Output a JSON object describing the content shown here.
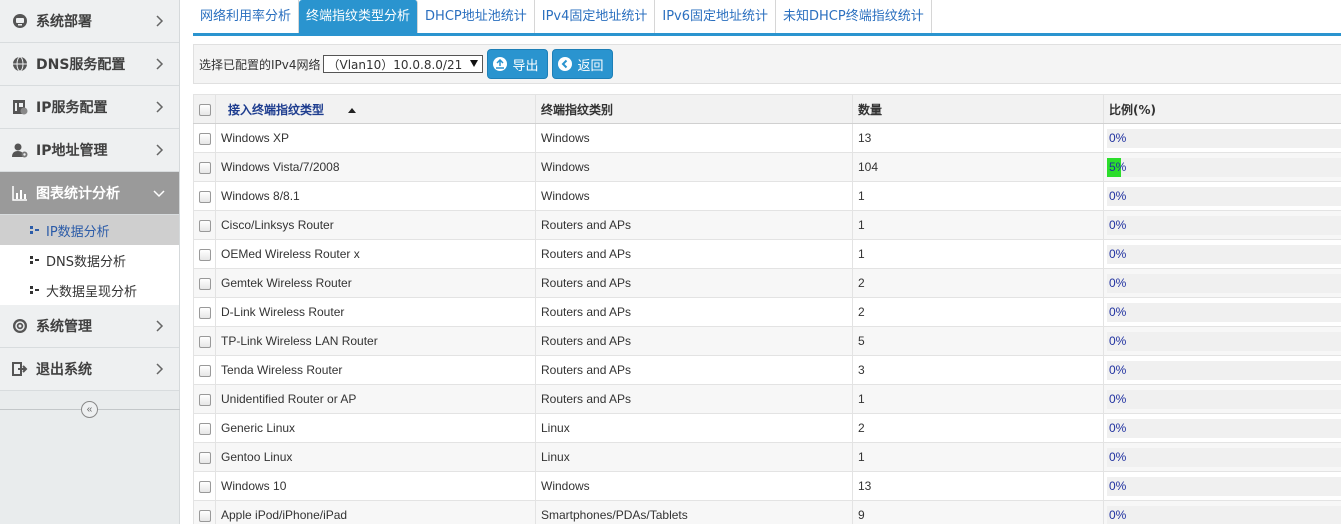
{
  "sidebar": {
    "items": [
      {
        "label": "系统部署",
        "icon": "deploy-icon"
      },
      {
        "label": "DNS服务配置",
        "icon": "globe-icon"
      },
      {
        "label": "IP服务配置",
        "icon": "ip-config-icon"
      },
      {
        "label": "IP地址管理",
        "icon": "user-gear-icon"
      },
      {
        "label": "图表统计分析",
        "icon": "bar-chart-icon"
      }
    ],
    "subitems": [
      {
        "label": "IP数据分析"
      },
      {
        "label": "DNS数据分析"
      },
      {
        "label": "大数据呈现分析"
      }
    ],
    "bottom_items": [
      {
        "label": "系统管理",
        "icon": "gear-icon"
      },
      {
        "label": "退出系统",
        "icon": "logout-icon"
      }
    ],
    "collapse_symbol": "«"
  },
  "tabs": [
    {
      "label": "网络利用率分析"
    },
    {
      "label": "终端指纹类型分析"
    },
    {
      "label": "DHCP地址池统计"
    },
    {
      "label": "IPv4固定地址统计"
    },
    {
      "label": "IPv6固定地址统计"
    },
    {
      "label": "未知DHCP终端指纹统计"
    }
  ],
  "toolbar": {
    "network_label": "选择已配置的IPv4网络",
    "network_selected": "（Vlan10）10.0.8.0/21",
    "export_label": "导出",
    "back_label": "返回"
  },
  "table": {
    "headers": [
      "接入终端指纹类型",
      "终端指纹类别",
      "数量",
      "比例(%)"
    ],
    "rows": [
      {
        "type": "Windows XP",
        "category": "Windows",
        "count": "13",
        "ratio": "0%",
        "fill": 0
      },
      {
        "type": "Windows Vista/7/2008",
        "category": "Windows",
        "count": "104",
        "ratio": "5%",
        "fill": 5
      },
      {
        "type": "Windows 8/8.1",
        "category": "Windows",
        "count": "1",
        "ratio": "0%",
        "fill": 0
      },
      {
        "type": "Cisco/Linksys Router",
        "category": "Routers and APs",
        "count": "1",
        "ratio": "0%",
        "fill": 0
      },
      {
        "type": "OEMed Wireless Router x",
        "category": "Routers and APs",
        "count": "1",
        "ratio": "0%",
        "fill": 0
      },
      {
        "type": "Gemtek Wireless Router",
        "category": "Routers and APs",
        "count": "2",
        "ratio": "0%",
        "fill": 0
      },
      {
        "type": "D-Link Wireless Router",
        "category": "Routers and APs",
        "count": "2",
        "ratio": "0%",
        "fill": 0
      },
      {
        "type": "TP-Link Wireless LAN Router",
        "category": "Routers and APs",
        "count": "5",
        "ratio": "0%",
        "fill": 0
      },
      {
        "type": "Tenda Wireless Router",
        "category": "Routers and APs",
        "count": "3",
        "ratio": "0%",
        "fill": 0
      },
      {
        "type": "Unidentified Router or AP",
        "category": "Routers and APs",
        "count": "1",
        "ratio": "0%",
        "fill": 0
      },
      {
        "type": "Generic Linux",
        "category": "Linux",
        "count": "2",
        "ratio": "0%",
        "fill": 0
      },
      {
        "type": "Gentoo Linux",
        "category": "Linux",
        "count": "1",
        "ratio": "0%",
        "fill": 0
      },
      {
        "type": "Windows 10",
        "category": "Windows",
        "count": "13",
        "ratio": "0%",
        "fill": 0
      },
      {
        "type": "Apple iPod/iPhone/iPad",
        "category": "Smartphones/PDAs/Tablets",
        "count": "9",
        "ratio": "0%",
        "fill": 0
      }
    ]
  },
  "colors": {
    "accent": "#2a94cf",
    "ratio_fill": "#2bdd2b",
    "link": "#2031a0"
  }
}
